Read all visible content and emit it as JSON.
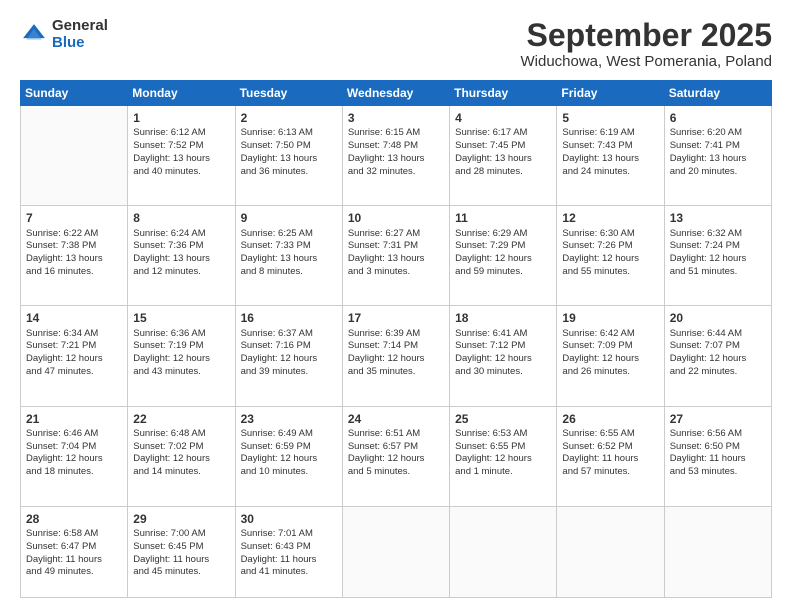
{
  "logo": {
    "general": "General",
    "blue": "Blue"
  },
  "header": {
    "month": "September 2025",
    "location": "Widuchowa, West Pomerania, Poland"
  },
  "days": [
    "Sunday",
    "Monday",
    "Tuesday",
    "Wednesday",
    "Thursday",
    "Friday",
    "Saturday"
  ],
  "weeks": [
    [
      {
        "day": "",
        "info": ""
      },
      {
        "day": "1",
        "info": "Sunrise: 6:12 AM\nSunset: 7:52 PM\nDaylight: 13 hours\nand 40 minutes."
      },
      {
        "day": "2",
        "info": "Sunrise: 6:13 AM\nSunset: 7:50 PM\nDaylight: 13 hours\nand 36 minutes."
      },
      {
        "day": "3",
        "info": "Sunrise: 6:15 AM\nSunset: 7:48 PM\nDaylight: 13 hours\nand 32 minutes."
      },
      {
        "day": "4",
        "info": "Sunrise: 6:17 AM\nSunset: 7:45 PM\nDaylight: 13 hours\nand 28 minutes."
      },
      {
        "day": "5",
        "info": "Sunrise: 6:19 AM\nSunset: 7:43 PM\nDaylight: 13 hours\nand 24 minutes."
      },
      {
        "day": "6",
        "info": "Sunrise: 6:20 AM\nSunset: 7:41 PM\nDaylight: 13 hours\nand 20 minutes."
      }
    ],
    [
      {
        "day": "7",
        "info": "Sunrise: 6:22 AM\nSunset: 7:38 PM\nDaylight: 13 hours\nand 16 minutes."
      },
      {
        "day": "8",
        "info": "Sunrise: 6:24 AM\nSunset: 7:36 PM\nDaylight: 13 hours\nand 12 minutes."
      },
      {
        "day": "9",
        "info": "Sunrise: 6:25 AM\nSunset: 7:33 PM\nDaylight: 13 hours\nand 8 minutes."
      },
      {
        "day": "10",
        "info": "Sunrise: 6:27 AM\nSunset: 7:31 PM\nDaylight: 13 hours\nand 3 minutes."
      },
      {
        "day": "11",
        "info": "Sunrise: 6:29 AM\nSunset: 7:29 PM\nDaylight: 12 hours\nand 59 minutes."
      },
      {
        "day": "12",
        "info": "Sunrise: 6:30 AM\nSunset: 7:26 PM\nDaylight: 12 hours\nand 55 minutes."
      },
      {
        "day": "13",
        "info": "Sunrise: 6:32 AM\nSunset: 7:24 PM\nDaylight: 12 hours\nand 51 minutes."
      }
    ],
    [
      {
        "day": "14",
        "info": "Sunrise: 6:34 AM\nSunset: 7:21 PM\nDaylight: 12 hours\nand 47 minutes."
      },
      {
        "day": "15",
        "info": "Sunrise: 6:36 AM\nSunset: 7:19 PM\nDaylight: 12 hours\nand 43 minutes."
      },
      {
        "day": "16",
        "info": "Sunrise: 6:37 AM\nSunset: 7:16 PM\nDaylight: 12 hours\nand 39 minutes."
      },
      {
        "day": "17",
        "info": "Sunrise: 6:39 AM\nSunset: 7:14 PM\nDaylight: 12 hours\nand 35 minutes."
      },
      {
        "day": "18",
        "info": "Sunrise: 6:41 AM\nSunset: 7:12 PM\nDaylight: 12 hours\nand 30 minutes."
      },
      {
        "day": "19",
        "info": "Sunrise: 6:42 AM\nSunset: 7:09 PM\nDaylight: 12 hours\nand 26 minutes."
      },
      {
        "day": "20",
        "info": "Sunrise: 6:44 AM\nSunset: 7:07 PM\nDaylight: 12 hours\nand 22 minutes."
      }
    ],
    [
      {
        "day": "21",
        "info": "Sunrise: 6:46 AM\nSunset: 7:04 PM\nDaylight: 12 hours\nand 18 minutes."
      },
      {
        "day": "22",
        "info": "Sunrise: 6:48 AM\nSunset: 7:02 PM\nDaylight: 12 hours\nand 14 minutes."
      },
      {
        "day": "23",
        "info": "Sunrise: 6:49 AM\nSunset: 6:59 PM\nDaylight: 12 hours\nand 10 minutes."
      },
      {
        "day": "24",
        "info": "Sunrise: 6:51 AM\nSunset: 6:57 PM\nDaylight: 12 hours\nand 5 minutes."
      },
      {
        "day": "25",
        "info": "Sunrise: 6:53 AM\nSunset: 6:55 PM\nDaylight: 12 hours\nand 1 minute."
      },
      {
        "day": "26",
        "info": "Sunrise: 6:55 AM\nSunset: 6:52 PM\nDaylight: 11 hours\nand 57 minutes."
      },
      {
        "day": "27",
        "info": "Sunrise: 6:56 AM\nSunset: 6:50 PM\nDaylight: 11 hours\nand 53 minutes."
      }
    ],
    [
      {
        "day": "28",
        "info": "Sunrise: 6:58 AM\nSunset: 6:47 PM\nDaylight: 11 hours\nand 49 minutes."
      },
      {
        "day": "29",
        "info": "Sunrise: 7:00 AM\nSunset: 6:45 PM\nDaylight: 11 hours\nand 45 minutes."
      },
      {
        "day": "30",
        "info": "Sunrise: 7:01 AM\nSunset: 6:43 PM\nDaylight: 11 hours\nand 41 minutes."
      },
      {
        "day": "",
        "info": ""
      },
      {
        "day": "",
        "info": ""
      },
      {
        "day": "",
        "info": ""
      },
      {
        "day": "",
        "info": ""
      }
    ]
  ]
}
